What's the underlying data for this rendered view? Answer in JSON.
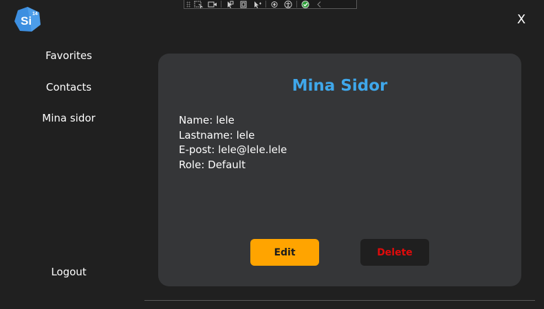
{
  "app": {
    "logo_text": "Si",
    "logo_badge": "14",
    "close_label": "X"
  },
  "nav": {
    "items": [
      {
        "label": "Favorites"
      },
      {
        "label": "Contacts"
      },
      {
        "label": "Mina sidor"
      }
    ],
    "logout_label": "Logout"
  },
  "toolbar": {
    "icons": [
      "select-element-icon",
      "video-icon",
      "pointer-icon",
      "frame-icon",
      "cursor-track-icon",
      "hot-reload-icon",
      "accessibility-icon",
      "check-icon",
      "collapse-chevron-icon"
    ]
  },
  "profile": {
    "title": "Mina Sidor",
    "name": "Name: lele",
    "lastname": "Lastname: lele",
    "email": "E-post: lele@lele.lele",
    "role": "Role: Default",
    "edit_label": "Edit",
    "delete_label": "Delete"
  },
  "colors": {
    "accent": "#3fa7ea",
    "edit": "#ffa400",
    "delete": "#e10b0b",
    "card": "#353638",
    "background": "#202020"
  }
}
